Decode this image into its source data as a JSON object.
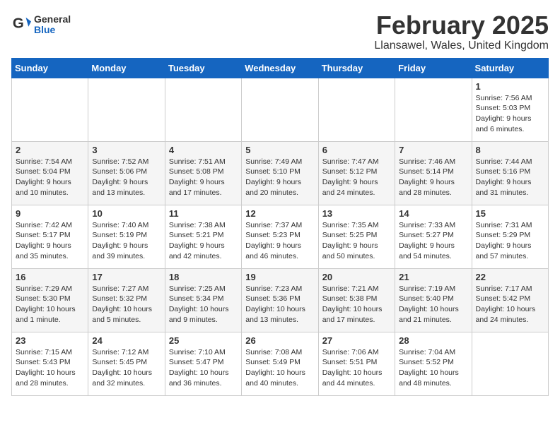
{
  "logo": {
    "general": "General",
    "blue": "Blue"
  },
  "title": "February 2025",
  "subtitle": "Llansawel, Wales, United Kingdom",
  "days_of_week": [
    "Sunday",
    "Monday",
    "Tuesday",
    "Wednesday",
    "Thursday",
    "Friday",
    "Saturday"
  ],
  "weeks": [
    [
      {
        "day": "",
        "info": ""
      },
      {
        "day": "",
        "info": ""
      },
      {
        "day": "",
        "info": ""
      },
      {
        "day": "",
        "info": ""
      },
      {
        "day": "",
        "info": ""
      },
      {
        "day": "",
        "info": ""
      },
      {
        "day": "1",
        "info": "Sunrise: 7:56 AM\nSunset: 5:03 PM\nDaylight: 9 hours and 6 minutes."
      }
    ],
    [
      {
        "day": "2",
        "info": "Sunrise: 7:54 AM\nSunset: 5:04 PM\nDaylight: 9 hours and 10 minutes."
      },
      {
        "day": "3",
        "info": "Sunrise: 7:52 AM\nSunset: 5:06 PM\nDaylight: 9 hours and 13 minutes."
      },
      {
        "day": "4",
        "info": "Sunrise: 7:51 AM\nSunset: 5:08 PM\nDaylight: 9 hours and 17 minutes."
      },
      {
        "day": "5",
        "info": "Sunrise: 7:49 AM\nSunset: 5:10 PM\nDaylight: 9 hours and 20 minutes."
      },
      {
        "day": "6",
        "info": "Sunrise: 7:47 AM\nSunset: 5:12 PM\nDaylight: 9 hours and 24 minutes."
      },
      {
        "day": "7",
        "info": "Sunrise: 7:46 AM\nSunset: 5:14 PM\nDaylight: 9 hours and 28 minutes."
      },
      {
        "day": "8",
        "info": "Sunrise: 7:44 AM\nSunset: 5:16 PM\nDaylight: 9 hours and 31 minutes."
      }
    ],
    [
      {
        "day": "9",
        "info": "Sunrise: 7:42 AM\nSunset: 5:17 PM\nDaylight: 9 hours and 35 minutes."
      },
      {
        "day": "10",
        "info": "Sunrise: 7:40 AM\nSunset: 5:19 PM\nDaylight: 9 hours and 39 minutes."
      },
      {
        "day": "11",
        "info": "Sunrise: 7:38 AM\nSunset: 5:21 PM\nDaylight: 9 hours and 42 minutes."
      },
      {
        "day": "12",
        "info": "Sunrise: 7:37 AM\nSunset: 5:23 PM\nDaylight: 9 hours and 46 minutes."
      },
      {
        "day": "13",
        "info": "Sunrise: 7:35 AM\nSunset: 5:25 PM\nDaylight: 9 hours and 50 minutes."
      },
      {
        "day": "14",
        "info": "Sunrise: 7:33 AM\nSunset: 5:27 PM\nDaylight: 9 hours and 54 minutes."
      },
      {
        "day": "15",
        "info": "Sunrise: 7:31 AM\nSunset: 5:29 PM\nDaylight: 9 hours and 57 minutes."
      }
    ],
    [
      {
        "day": "16",
        "info": "Sunrise: 7:29 AM\nSunset: 5:30 PM\nDaylight: 10 hours and 1 minute."
      },
      {
        "day": "17",
        "info": "Sunrise: 7:27 AM\nSunset: 5:32 PM\nDaylight: 10 hours and 5 minutes."
      },
      {
        "day": "18",
        "info": "Sunrise: 7:25 AM\nSunset: 5:34 PM\nDaylight: 10 hours and 9 minutes."
      },
      {
        "day": "19",
        "info": "Sunrise: 7:23 AM\nSunset: 5:36 PM\nDaylight: 10 hours and 13 minutes."
      },
      {
        "day": "20",
        "info": "Sunrise: 7:21 AM\nSunset: 5:38 PM\nDaylight: 10 hours and 17 minutes."
      },
      {
        "day": "21",
        "info": "Sunrise: 7:19 AM\nSunset: 5:40 PM\nDaylight: 10 hours and 21 minutes."
      },
      {
        "day": "22",
        "info": "Sunrise: 7:17 AM\nSunset: 5:42 PM\nDaylight: 10 hours and 24 minutes."
      }
    ],
    [
      {
        "day": "23",
        "info": "Sunrise: 7:15 AM\nSunset: 5:43 PM\nDaylight: 10 hours and 28 minutes."
      },
      {
        "day": "24",
        "info": "Sunrise: 7:12 AM\nSunset: 5:45 PM\nDaylight: 10 hours and 32 minutes."
      },
      {
        "day": "25",
        "info": "Sunrise: 7:10 AM\nSunset: 5:47 PM\nDaylight: 10 hours and 36 minutes."
      },
      {
        "day": "26",
        "info": "Sunrise: 7:08 AM\nSunset: 5:49 PM\nDaylight: 10 hours and 40 minutes."
      },
      {
        "day": "27",
        "info": "Sunrise: 7:06 AM\nSunset: 5:51 PM\nDaylight: 10 hours and 44 minutes."
      },
      {
        "day": "28",
        "info": "Sunrise: 7:04 AM\nSunset: 5:52 PM\nDaylight: 10 hours and 48 minutes."
      },
      {
        "day": "",
        "info": ""
      }
    ]
  ]
}
